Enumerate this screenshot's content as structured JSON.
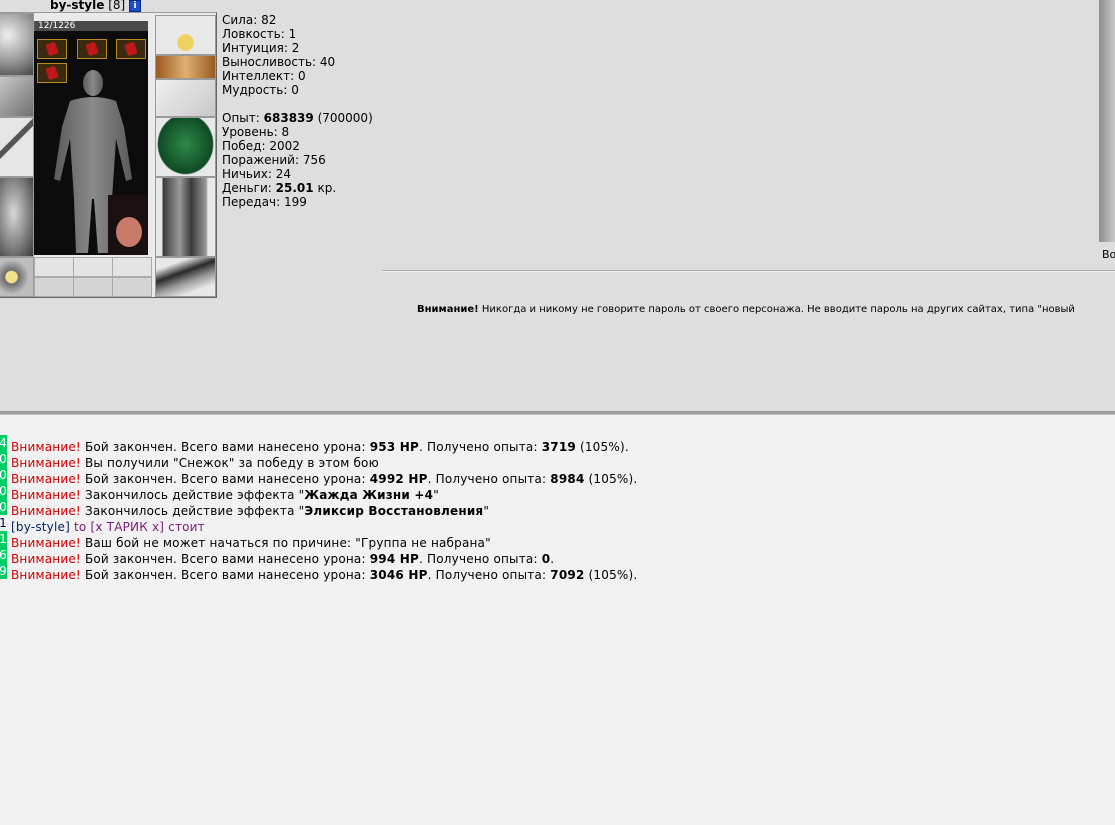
{
  "character": {
    "name": "by-style",
    "level_bracket": "[8]",
    "info_icon": "i",
    "hp": "12/1226",
    "hp_fraction": 0.0098
  },
  "stats": [
    {
      "label": "Сила:",
      "value": "82"
    },
    {
      "label": "Ловкость:",
      "value": "1"
    },
    {
      "label": "Интуиция:",
      "value": "2"
    },
    {
      "label": "Выносливость:",
      "value": "40"
    },
    {
      "label": "Интеллект:",
      "value": "0"
    },
    {
      "label": "Мудрость:",
      "value": "0"
    }
  ],
  "progress": {
    "exp_label": "Опыт:",
    "exp_value": "683839",
    "exp_next": "(700000)",
    "level_label": "Уровень:",
    "level_value": "8",
    "wins_label": "Побед:",
    "wins_value": "2002",
    "losses_label": "Поражений:",
    "losses_value": "756",
    "draws_label": "Ничьих:",
    "draws_value": "24",
    "money_label": "Деньги:",
    "money_value": "25.01",
    "money_unit": "кр.",
    "transfers_label": "Передач:",
    "transfers_value": "199"
  },
  "right_caption": "Во",
  "warning": {
    "title": "Внимание!",
    "text": " Никогда и никому не говорите пароль от своего персонажа. Не вводите пароль на других сайтах, типа \"новый"
  },
  "chat": {
    "lines": [
      {
        "ts": "4",
        "hl": true,
        "prefix": "Внимание!",
        "parts": [
          "Бой закончен. Всего вами нанесено урона: ",
          "953 HP",
          ". Получено опыта: ",
          "3719",
          " (105%)."
        ]
      },
      {
        "ts": "0",
        "hl": true,
        "prefix": "Внимание!",
        "parts": [
          "Вы получили \"Снежок\" за победу в этом бою"
        ]
      },
      {
        "ts": "0",
        "hl": true,
        "prefix": "Внимание!",
        "parts": [
          "Бой закончен. Всего вами нанесено урона: ",
          "4992 HP",
          ". Получено опыта: ",
          "8984",
          " (105%)."
        ]
      },
      {
        "ts": "0",
        "hl": true,
        "prefix": "Внимание!",
        "parts": [
          "Закончилось действие эффекта \"",
          "Жажда Жизни +4",
          "\""
        ]
      },
      {
        "ts": "0",
        "hl": true,
        "prefix": "Внимание!",
        "parts": [
          "Закончилось действие эффекта \"",
          "Эликсир Восстановления",
          "\""
        ]
      },
      {
        "ts": "1",
        "hl": false,
        "from": "[by-style]",
        "pm": " to [x ТАРИК x] стоит"
      },
      {
        "ts": "1",
        "hl": true,
        "prefix": "Внимание!",
        "parts": [
          "Ваш бой не может начаться по причине: \"Группа не набрана\""
        ]
      },
      {
        "ts": "6",
        "hl": true,
        "prefix": "Внимание!",
        "parts": [
          "Бой закончен. Всего вами нанесено урона: ",
          "994 HP",
          ". Получено опыта: ",
          "0",
          "."
        ]
      },
      {
        "ts": "9",
        "hl": true,
        "prefix": "Внимание!",
        "parts": [
          "Бой закончен. Всего вами нанесено урона: ",
          "3046 HP",
          ". Получено опыта: ",
          "7092",
          " (105%)."
        ]
      }
    ]
  },
  "colors": {
    "warning_red": "#cc0000",
    "timestamp_green": "#00cc66",
    "nick_navy": "#00225c",
    "private_purple": "#7a1a7a"
  }
}
